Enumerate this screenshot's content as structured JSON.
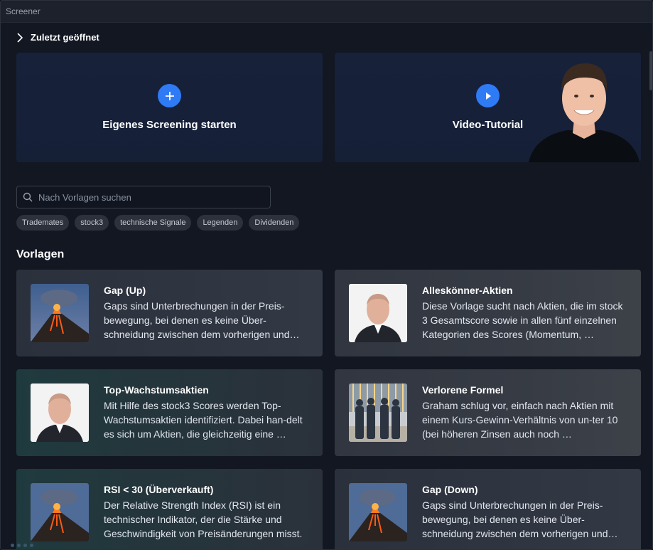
{
  "window": {
    "title": "Screener"
  },
  "recent": {
    "label": "Zuletzt geöffnet"
  },
  "hero": {
    "custom": {
      "label": "Eigenes Screening starten",
      "icon": "plus-icon"
    },
    "video": {
      "label": "Video-Tutorial",
      "icon": "play-icon"
    }
  },
  "search": {
    "placeholder": "Nach Vorlagen suchen",
    "value": ""
  },
  "chips": [
    "Trademates",
    "stock3",
    "technische Signale",
    "Legenden",
    "Dividenden"
  ],
  "section": {
    "title": "Vorlagen"
  },
  "templates": [
    {
      "title": "Gap (Up)",
      "desc": "Gaps sind Unterbrechungen in der Preis-bewegung, bei denen es keine Über-schneidung zwischen dem vorherigen und dem aktuellen Kurs gibt.",
      "image": "volcano"
    },
    {
      "title": "Alleskönner-Aktien",
      "desc": "Diese Vorlage sucht nach Aktien, die im stock 3 Gesamtscore sowie in allen fünf einzelnen Kategorien des Scores (Momentum, …",
      "image": "portrait"
    },
    {
      "title": "Top-Wachstumsaktien",
      "desc": "Mit Hilfe des stock3 Scores werden Top-Wachstumsaktien identifiziert. Dabei han-delt es sich um Aktien, die gleichzeitig eine …",
      "image": "portrait"
    },
    {
      "title": "Verlorene Formel",
      "desc": "Graham schlug vor, einfach nach Aktien mit einem Kurs-Gewinn-Verhältnis von un-ter 10 (bei höheren Zinsen auch noch …",
      "image": "businessmen"
    },
    {
      "title": "RSI < 30 (Überverkauft)",
      "desc": "Der Relative Strength Index (RSI) ist ein technischer Indikator, der die Stärke und Geschwindigkeit von Preisänderungen misst.",
      "image": "volcano"
    },
    {
      "title": "Gap (Down)",
      "desc": "Gaps sind Unterbrechungen in der Preis-bewegung, bei denen es keine Über-schneidung zwischen dem vorherigen und dem aktuellen Kurs gibt.",
      "image": "volcano"
    }
  ],
  "colors": {
    "accent": "#2f7bf6",
    "background": "#121722",
    "card": "#17203a"
  }
}
